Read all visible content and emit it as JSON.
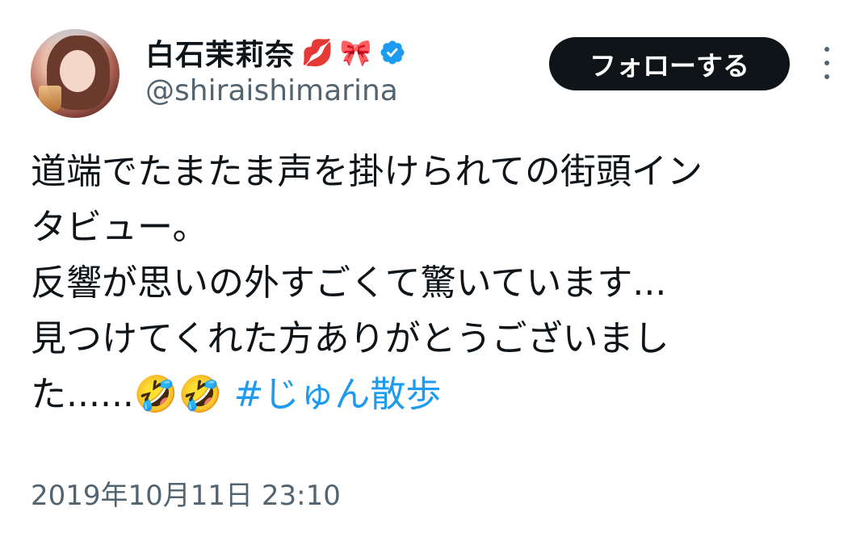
{
  "author": {
    "display_name": "白石茉莉奈",
    "name_emojis": [
      "💋",
      "🎀"
    ],
    "handle": "@shiraishimarina",
    "verified": true
  },
  "follow_button": {
    "label": "フォローする"
  },
  "icons": {
    "more": "more-vertical-icon",
    "verified": "verified-badge-icon"
  },
  "colors": {
    "text": "#0f1419",
    "secondary": "#536471",
    "link": "#1d9bf0",
    "follow_bg": "#0f1419",
    "verified": "#1d9bf0"
  },
  "tweet": {
    "lines": [
      "道端でたまたま声を掛けられての街頭イン",
      "タビュー。",
      "反響が思いの外すごくて驚いています...",
      "見つけてくれた方ありがとうございまし"
    ],
    "last_line_text": "た......",
    "last_line_emojis": "🤣🤣",
    "hashtag": "#じゅん散歩"
  },
  "timestamp": "2019年10月11日 23:10"
}
